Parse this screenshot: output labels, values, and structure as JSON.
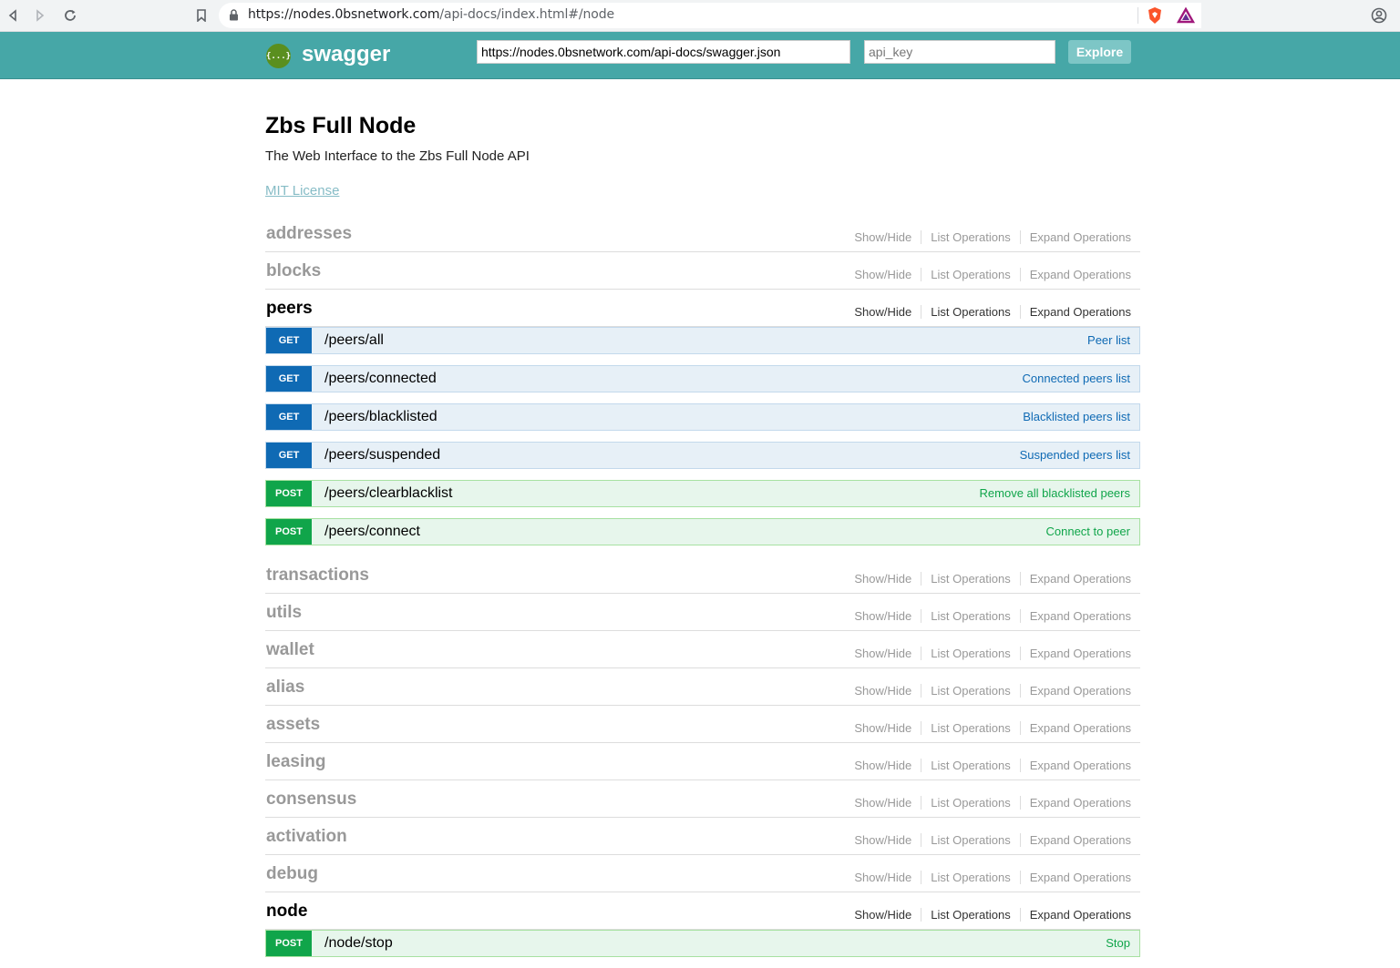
{
  "browser": {
    "url_host": "https://nodes.0bsnetwork.com",
    "url_path": "/api-docs/index.html#/node"
  },
  "header": {
    "logo_glyph": "{...}",
    "logo_text": "swagger",
    "spec_url": "https://nodes.0bsnetwork.com/api-docs/swagger.json",
    "api_key_placeholder": "api_key",
    "explore_label": "Explore"
  },
  "info": {
    "title": "Zbs Full Node",
    "description": "The Web Interface to the Zbs Full Node API",
    "license": "MIT License"
  },
  "actions": {
    "show_hide": "Show/Hide",
    "list_ops": "List Operations",
    "expand_ops": "Expand Operations"
  },
  "resources": [
    {
      "name": "addresses",
      "active": false,
      "operations": []
    },
    {
      "name": "blocks",
      "active": false,
      "operations": []
    },
    {
      "name": "peers",
      "active": true,
      "operations": [
        {
          "method": "GET",
          "path": "/peers/all",
          "summary": "Peer list"
        },
        {
          "method": "GET",
          "path": "/peers/connected",
          "summary": "Connected peers list"
        },
        {
          "method": "GET",
          "path": "/peers/blacklisted",
          "summary": "Blacklisted peers list"
        },
        {
          "method": "GET",
          "path": "/peers/suspended",
          "summary": "Suspended peers list"
        },
        {
          "method": "POST",
          "path": "/peers/clearblacklist",
          "summary": "Remove all blacklisted peers"
        },
        {
          "method": "POST",
          "path": "/peers/connect",
          "summary": "Connect to peer"
        }
      ]
    },
    {
      "name": "transactions",
      "active": false,
      "operations": []
    },
    {
      "name": "utils",
      "active": false,
      "operations": []
    },
    {
      "name": "wallet",
      "active": false,
      "operations": []
    },
    {
      "name": "alias",
      "active": false,
      "operations": []
    },
    {
      "name": "assets",
      "active": false,
      "operations": []
    },
    {
      "name": "leasing",
      "active": false,
      "operations": []
    },
    {
      "name": "consensus",
      "active": false,
      "operations": []
    },
    {
      "name": "activation",
      "active": false,
      "operations": []
    },
    {
      "name": "debug",
      "active": false,
      "operations": []
    },
    {
      "name": "node",
      "active": true,
      "operations": [
        {
          "method": "POST",
          "path": "/node/stop",
          "summary": "Stop"
        }
      ]
    }
  ],
  "colors": {
    "header_bg": "#46a7a7",
    "get": "#0f6ab4",
    "post": "#10a54a"
  }
}
